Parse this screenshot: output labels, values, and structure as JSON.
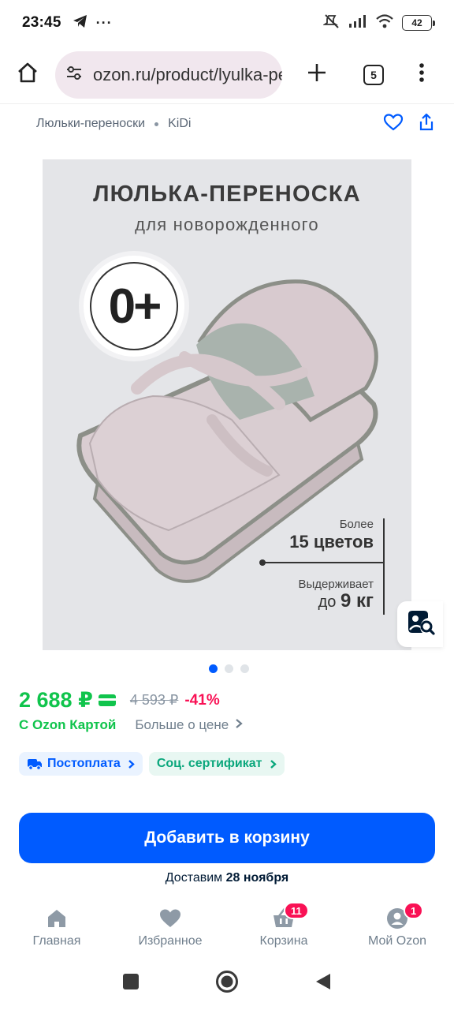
{
  "status_bar": {
    "time": "23:45",
    "overflow": "···",
    "battery": "42"
  },
  "browser": {
    "url": "ozon.ru/product/lyulka-pere",
    "tab_count": "5"
  },
  "breadcrumb": {
    "items": [
      "Люльки-переноски",
      "KiDi"
    ]
  },
  "product_image": {
    "title": "ЛЮЛЬКА-ПЕРЕНОСКА",
    "subtitle": "для новорожденного",
    "age_badge": "0+",
    "feature_1_small": "Более",
    "feature_1_big": "15 цветов",
    "feature_2_small": "Выдерживает",
    "feature_2_prefix": "до ",
    "feature_2_value": "9 кг",
    "carousel_total": 3,
    "carousel_active": 1
  },
  "price": {
    "current": "2 688 ₽",
    "old": "4 593 ₽",
    "discount": "-41%",
    "card_label": "С Ozon Картой",
    "more_label": "Больше о цене"
  },
  "chips": [
    {
      "label": "Постоплата",
      "icon": "truck-card-icon"
    },
    {
      "label": "Соц. сертификат",
      "icon": ""
    }
  ],
  "cart": {
    "button_label": "Добавить в корзину",
    "delivery_prefix": "Доставим ",
    "delivery_date": "28 ноября"
  },
  "tabs": [
    {
      "label": "Главная",
      "icon": "home-icon",
      "badge": ""
    },
    {
      "label": "Избранное",
      "icon": "heart-icon",
      "badge": ""
    },
    {
      "label": "Корзина",
      "icon": "basket-icon",
      "badge": "11"
    },
    {
      "label": "Мой Ozon",
      "icon": "profile-icon",
      "badge": "1"
    }
  ],
  "colors": {
    "accent": "#005bff",
    "price_green": "#10c44c",
    "discount_red": "#f91155",
    "muted": "#707f8d"
  }
}
